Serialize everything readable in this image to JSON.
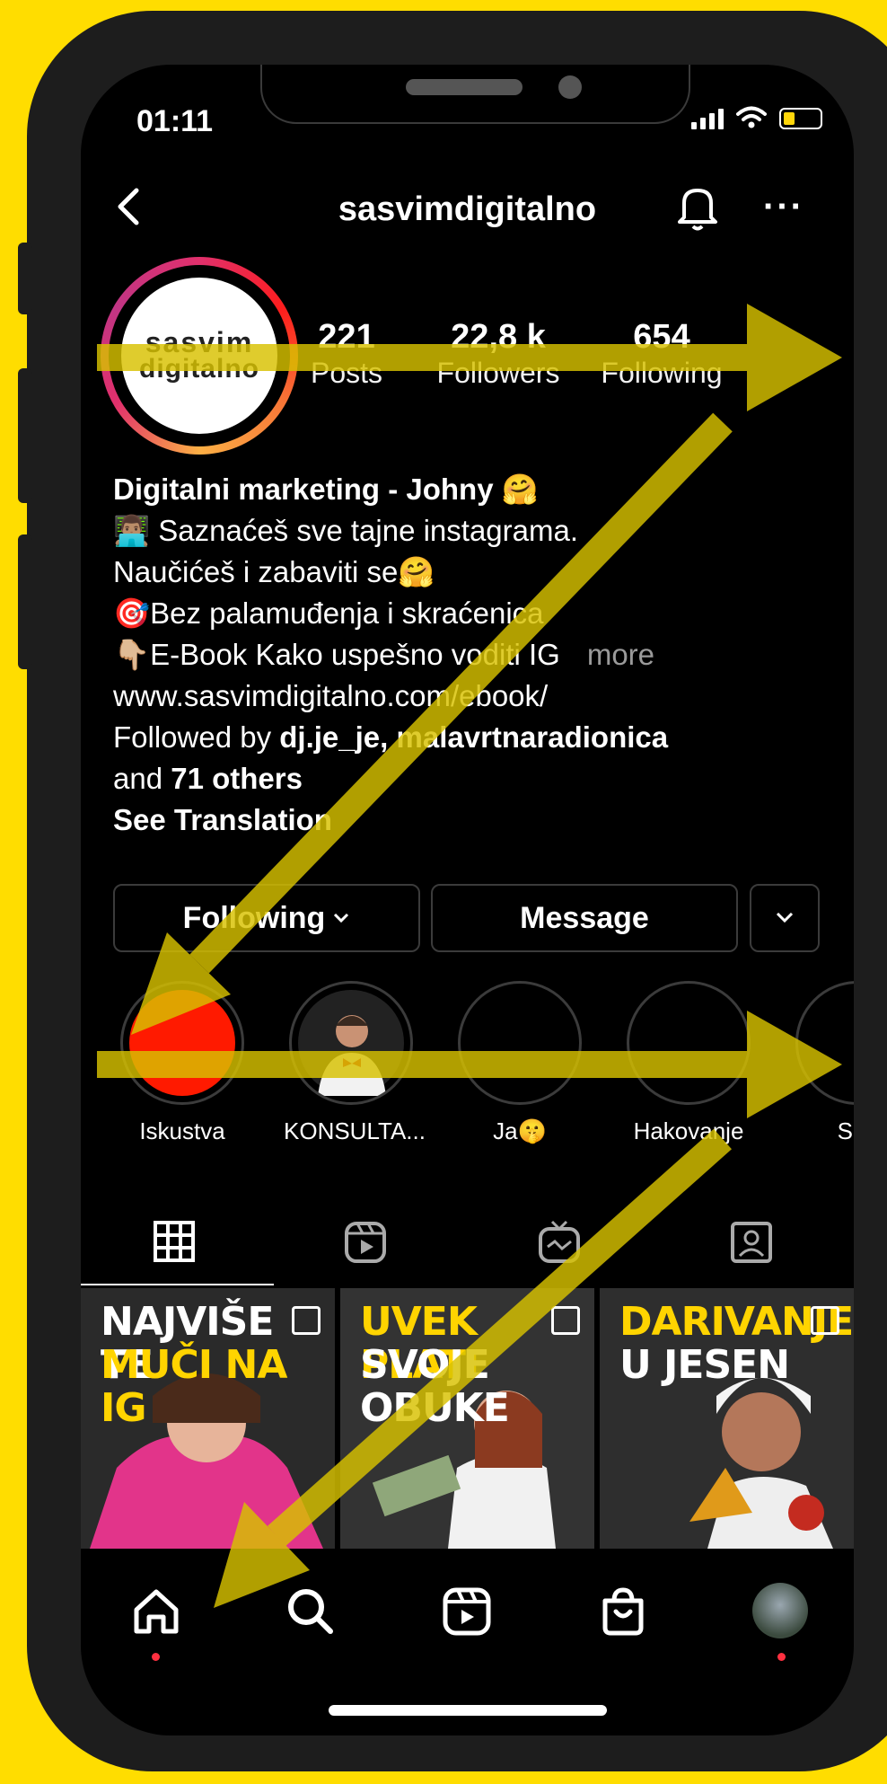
{
  "status_bar": {
    "time": "01:11"
  },
  "header": {
    "username": "sasvimdigitalno"
  },
  "profile": {
    "avatar_text_line1": "sasvim",
    "avatar_text_line2": "digitalno",
    "stats": [
      {
        "value": "221",
        "label": "Posts"
      },
      {
        "value": "22,8 k",
        "label": "Followers"
      },
      {
        "value": "654",
        "label": "Following"
      }
    ]
  },
  "bio": {
    "name": "Digitalni marketing - Johny 🤗",
    "line1": "👨🏽‍💻 Saznaćeš sve tajne instagrama.",
    "line2": "Naučićeš i zabaviti se🤗",
    "line3": "🎯Bez palamuđenja i skraćenica",
    "line4": "👇🏼E-Book Kako uspešno voditi IG",
    "more": "more",
    "link": "www.sasvimdigitalno.com/ebook/",
    "followed_by_prefix": "Followed by ",
    "followed_by_names": "dj.je_je, malavrtnaradionica",
    "and_prefix": "and ",
    "others": "71 others",
    "see_translation": "See Translation"
  },
  "actions": {
    "following": "Following",
    "message": "Message"
  },
  "highlights": [
    {
      "label": "Iskustva"
    },
    {
      "label": "KONSULTA..."
    },
    {
      "label": "Ja🤫"
    },
    {
      "label": "Hakovanje"
    },
    {
      "label": "Sav"
    }
  ],
  "posts": [
    {
      "line1": "NAJVIŠE TE",
      "line2": "MUČI NA IG",
      "line3": ""
    },
    {
      "line1": "UVEK PLATI",
      "line2": "SVOJE",
      "line3": "OBUKE"
    },
    {
      "line1": "DARIVANJE",
      "line2": "U JESEN",
      "line3": ""
    }
  ],
  "colors": {
    "background": "#ffdd00",
    "arrow": "#d8c200",
    "highlight_red": "#ff1a00",
    "post_yellow": "#ffd400"
  }
}
